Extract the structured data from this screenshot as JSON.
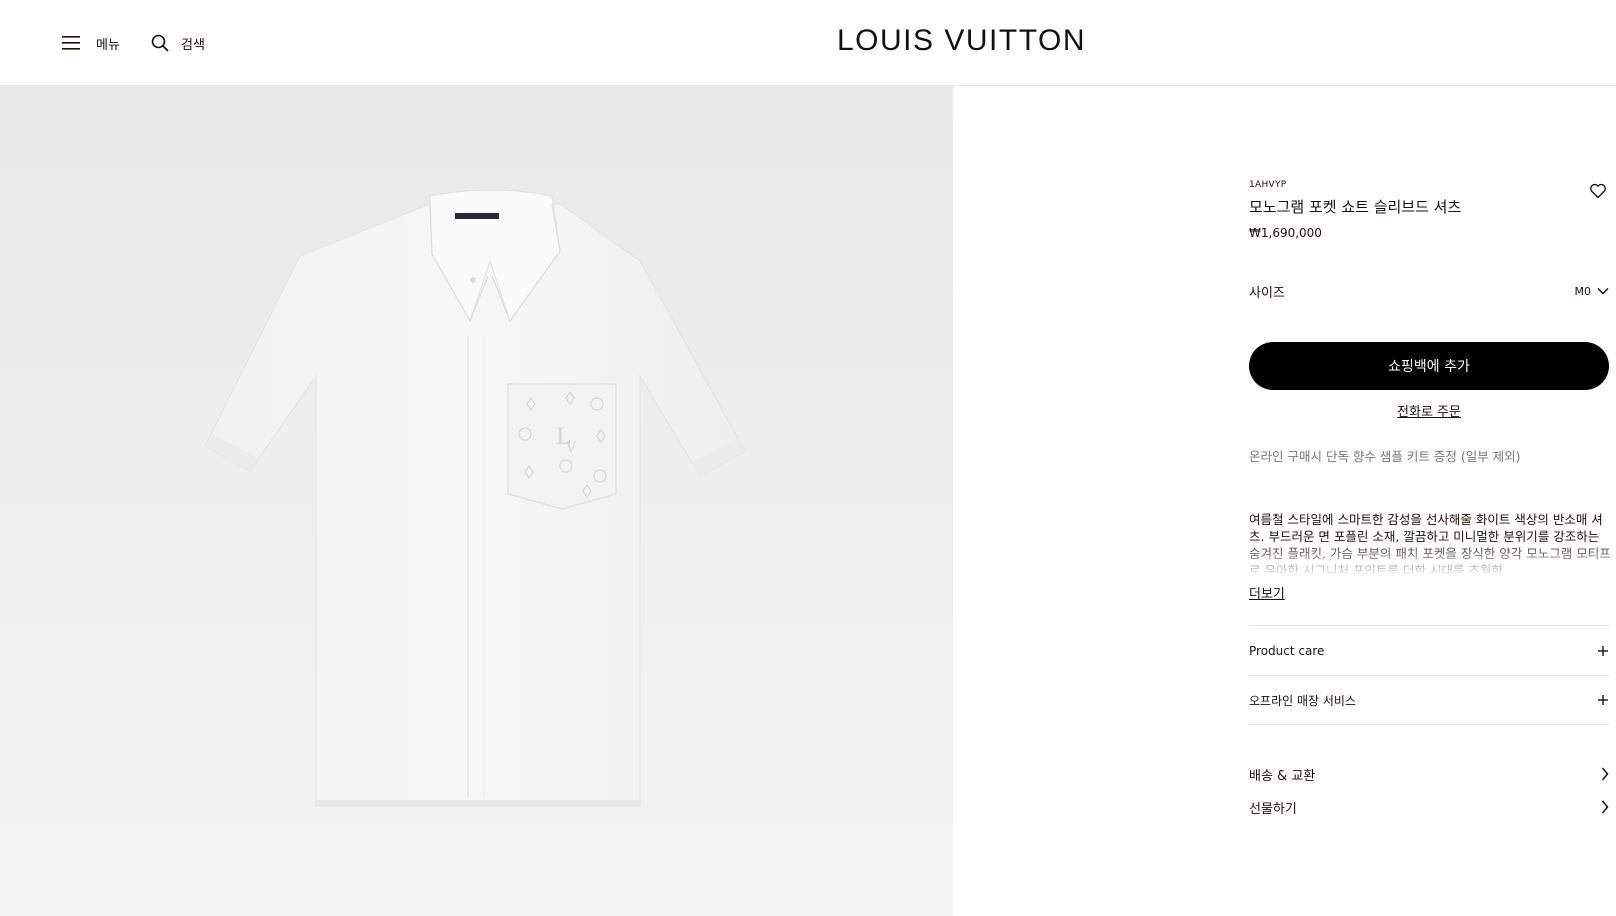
{
  "header": {
    "menu_label": "메뉴",
    "search_label": "검색",
    "logo_text": "LOUIS VUITTON"
  },
  "product": {
    "sku": "1AHVYP",
    "title": "모노그램 포켓 쇼트 슬리브드 셔츠",
    "price": "₩1,690,000",
    "size_label": "사이즈",
    "size_value": "M0",
    "add_to_bag": "쇼핑백에 추가",
    "phone_order": "전화로 주문",
    "promo": "온라인 구매시 단독 향수 샘플 키트 증정 (일부 제외)",
    "description": "여름철 스타일에 스마트한 감성을 선사해줄 화이트 색상의 반소매 셔츠. 부드러운 면 포플린 소재, 깔끔하고 미니멀한 분위기를 강조하는 숨겨진 플래킷, 가슴 부분의 패치 포켓을 장식한 양각 모노그램 모티프로 우아한 시그니처 포인트를 더한 시대를 초월한",
    "read_more": "더보기",
    "accordions": [
      {
        "label": "Product care"
      },
      {
        "label": "오프라인 매장 서비스"
      }
    ],
    "links": [
      {
        "label": "배송 & 교환"
      },
      {
        "label": "선물하기"
      }
    ],
    "label_tag": "LOUIS VUITTON"
  },
  "colors": {
    "text": "#19110b",
    "button_bg": "#000000",
    "muted": "#767676"
  },
  "icons": [
    "hamburger-menu-icon",
    "search-icon",
    "heart-icon",
    "chevron-down-icon",
    "plus-icon",
    "chevron-right-icon"
  ]
}
